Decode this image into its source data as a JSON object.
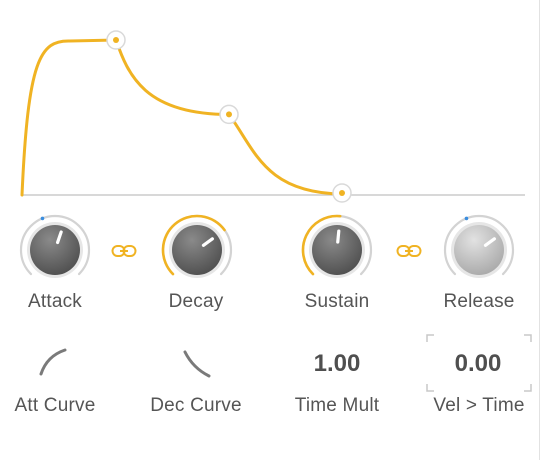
{
  "colors": {
    "accent": "#f0b323",
    "ring_inactive": "#d3d3d3",
    "knob_dark": "#6b6b6b",
    "knob_light": "#bdbdbd",
    "baseline": "#cccccc",
    "text": "#555555"
  },
  "envelope": {
    "attack_level": 1.0,
    "sustain_level": 0.52,
    "end_level": 0.0
  },
  "knobs": [
    {
      "label": "Attack",
      "value": 0.57,
      "accent_arc": false,
      "style": "dark",
      "indicator": "blue-dot"
    },
    {
      "label": "Decay",
      "value": 0.7,
      "accent_arc": true,
      "style": "dark"
    },
    {
      "label": "Sustain",
      "value": 0.52,
      "accent_arc": true,
      "style": "dark"
    },
    {
      "label": "Release",
      "value": 0.7,
      "accent_arc": false,
      "style": "light",
      "indicator": "blue-dot"
    }
  ],
  "links": [
    {
      "icon": "link-icon",
      "between": [
        "Attack",
        "Decay"
      ]
    },
    {
      "icon": "link-icon",
      "between": [
        "Sustain",
        "Release"
      ]
    }
  ],
  "controls": [
    {
      "label": "Att Curve",
      "kind": "curve",
      "icon": "curve-rising-icon"
    },
    {
      "label": "Dec Curve",
      "kind": "curve",
      "icon": "curve-falling-icon"
    },
    {
      "label": "Time Mult",
      "kind": "value",
      "value": "1.00"
    },
    {
      "label": "Vel > Time",
      "kind": "value",
      "value": "0.00",
      "highlighted": true
    }
  ]
}
